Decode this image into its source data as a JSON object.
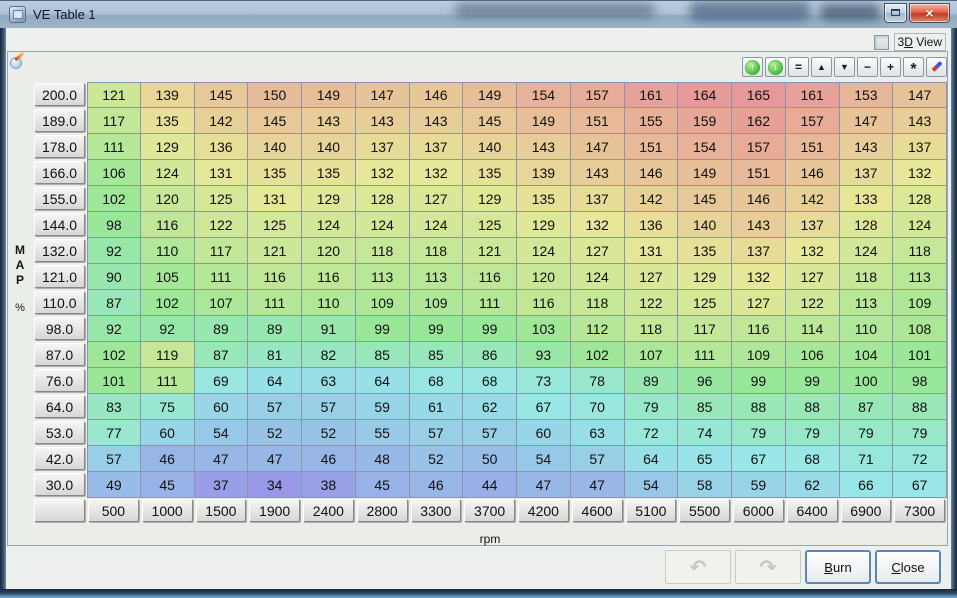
{
  "window": {
    "title": "VE Table 1",
    "controls": {
      "maximize": "maximize",
      "close": "close",
      "close_glyph": "×"
    }
  },
  "colors": {
    "accent_button_border": "#5b87b4",
    "close_button_red": "#d6493a",
    "grid_line": "#8b94ae",
    "titlebar_glass": "#a7bbcf"
  },
  "view3d": {
    "label": "3D View",
    "accel": 1,
    "checked": false
  },
  "toolbar": {
    "buttons": [
      {
        "name": "green-up-arrow-button",
        "type": "green",
        "glyph": "↑"
      },
      {
        "name": "green-down-arrow-button",
        "type": "green",
        "glyph": "↓"
      },
      {
        "name": "set-equal-button",
        "type": "text",
        "glyph": "="
      },
      {
        "name": "increment-button",
        "type": "tri",
        "glyph": "▲"
      },
      {
        "name": "decrement-button",
        "type": "tri",
        "glyph": "▼"
      },
      {
        "name": "subtract-button",
        "type": "text",
        "glyph": "−"
      },
      {
        "name": "add-button",
        "type": "text",
        "glyph": "+"
      },
      {
        "name": "scale-multiply-button",
        "type": "star",
        "glyph": "*"
      },
      {
        "name": "pencil-edit-button",
        "type": "pencil",
        "glyph": ""
      }
    ]
  },
  "axes": {
    "map_title": "MAP",
    "map_unit": "%",
    "rpm_title": "rpm",
    "map_bins": [
      "200.0",
      "189.0",
      "178.0",
      "166.0",
      "155.0",
      "144.0",
      "132.0",
      "121.0",
      "110.0",
      "98.0",
      "87.0",
      "76.0",
      "64.0",
      "53.0",
      "42.0",
      "30.0"
    ],
    "rpm_bins": [
      "500",
      "1000",
      "1500",
      "1900",
      "2400",
      "2800",
      "3300",
      "3700",
      "4200",
      "4600",
      "5100",
      "5500",
      "6000",
      "6400",
      "6900",
      "7300"
    ]
  },
  "heat": {
    "min": 34,
    "max": 165
  },
  "table_values": [
    [
      121,
      139,
      145,
      150,
      149,
      147,
      146,
      149,
      154,
      157,
      161,
      164,
      165,
      161,
      153,
      147
    ],
    [
      117,
      135,
      142,
      145,
      143,
      143,
      143,
      145,
      149,
      151,
      155,
      159,
      162,
      157,
      147,
      143
    ],
    [
      111,
      129,
      136,
      140,
      140,
      137,
      137,
      140,
      143,
      147,
      151,
      154,
      157,
      151,
      143,
      137
    ],
    [
      106,
      124,
      131,
      135,
      135,
      132,
      132,
      135,
      139,
      143,
      146,
      149,
      151,
      146,
      137,
      132
    ],
    [
      102,
      120,
      125,
      131,
      129,
      128,
      127,
      129,
      135,
      137,
      142,
      145,
      146,
      142,
      133,
      128
    ],
    [
      98,
      116,
      122,
      125,
      124,
      124,
      124,
      125,
      129,
      132,
      136,
      140,
      143,
      137,
      128,
      124
    ],
    [
      92,
      110,
      117,
      121,
      120,
      118,
      118,
      121,
      124,
      127,
      131,
      135,
      137,
      132,
      124,
      118
    ],
    [
      90,
      105,
      111,
      116,
      116,
      113,
      113,
      116,
      120,
      124,
      127,
      129,
      132,
      127,
      118,
      113
    ],
    [
      87,
      102,
      107,
      111,
      110,
      109,
      109,
      111,
      116,
      118,
      122,
      125,
      127,
      122,
      113,
      109
    ],
    [
      92,
      92,
      89,
      89,
      91,
      99,
      99,
      99,
      103,
      112,
      118,
      117,
      116,
      114,
      110,
      108
    ],
    [
      102,
      119,
      87,
      81,
      82,
      85,
      85,
      86,
      93,
      102,
      107,
      111,
      109,
      106,
      104,
      101
    ],
    [
      101,
      111,
      69,
      64,
      63,
      64,
      68,
      68,
      73,
      78,
      89,
      96,
      99,
      99,
      100,
      98
    ],
    [
      83,
      75,
      60,
      57,
      57,
      59,
      61,
      62,
      67,
      70,
      79,
      85,
      88,
      88,
      87,
      88
    ],
    [
      77,
      60,
      54,
      52,
      52,
      55,
      57,
      57,
      60,
      63,
      72,
      74,
      79,
      79,
      79,
      79
    ],
    [
      57,
      46,
      47,
      47,
      46,
      48,
      52,
      50,
      54,
      57,
      64,
      65,
      67,
      68,
      71,
      72
    ],
    [
      49,
      45,
      37,
      34,
      38,
      45,
      46,
      44,
      47,
      47,
      54,
      58,
      59,
      62,
      66,
      67
    ]
  ],
  "footer": {
    "undo": {
      "name": "undo-button",
      "glyph": "↶"
    },
    "redo": {
      "name": "redo-button",
      "glyph": "↷"
    },
    "burn": {
      "label": "Burn",
      "accel": 0
    },
    "close": {
      "label": "Close",
      "accel": 0
    }
  }
}
